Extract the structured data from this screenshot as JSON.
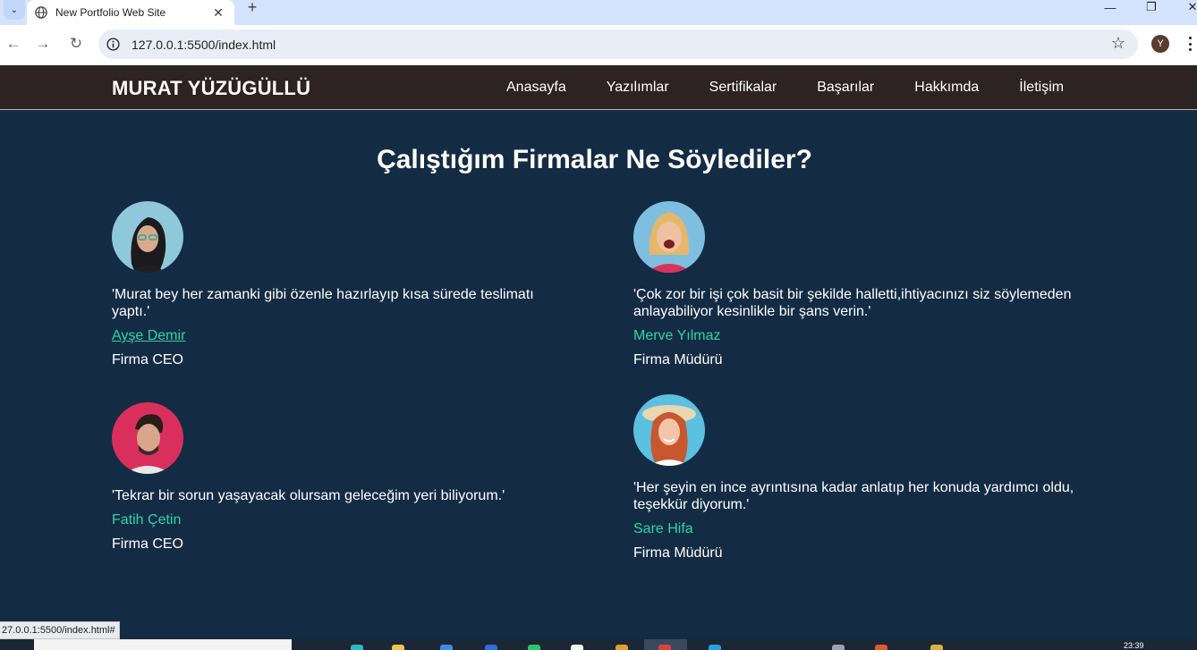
{
  "browser": {
    "tab_title": "New Portfolio Web Site",
    "url": "127.0.0.1:5500/index.html",
    "profile_initial": "Y",
    "status_url": "27.0.0.1:5500/index.html#"
  },
  "site": {
    "brand": "MURAT YÜZÜGÜLLÜ",
    "nav": [
      "Anasayfa",
      "Yazılımlar",
      "Sertifikalar",
      "Başarılar",
      "Hakkımda",
      "İletişim"
    ]
  },
  "testimonials": {
    "heading": "Çalıştığım Firmalar Ne Söylediler?",
    "items": [
      {
        "quote": "'Murat bey her zamanki gibi özenle hazırlayıp kısa sürede teslimatı yaptı.'",
        "name": "Ayşe Demir",
        "role": "Firma CEO"
      },
      {
        "quote": "'Çok zor bir işi çok basit bir şekilde halletti,ihtiyacınızı siz söylemeden anlayabiliyor kesinlikle bir şans verin.'",
        "name": "Merve Yılmaz",
        "role": "Firma Müdürü"
      },
      {
        "quote": "'Tekrar bir sorun yaşayacak olursam geleceğim yeri biliyorum.'",
        "name": "Fatih Çetin",
        "role": "Firma CEO"
      },
      {
        "quote": "'Her şeyin en ince ayrıntısına kadar anlatıp her konuda yardımcı oldu, teşekkür diyorum.'",
        "name": "Sare Hifa",
        "role": "Firma Müdürü"
      }
    ]
  },
  "taskbar": {
    "time": "23:39"
  },
  "colors": {
    "page_bg": "#132c44",
    "navbar_bg": "#2c2322",
    "accent": "#2dd4a8",
    "text": "#ffffff"
  },
  "icons": [
    "globe-icon",
    "close-icon",
    "plus-icon",
    "back-arrow-icon",
    "forward-arrow-icon",
    "reload-icon",
    "info-icon",
    "star-icon",
    "menu-dots-icon"
  ]
}
